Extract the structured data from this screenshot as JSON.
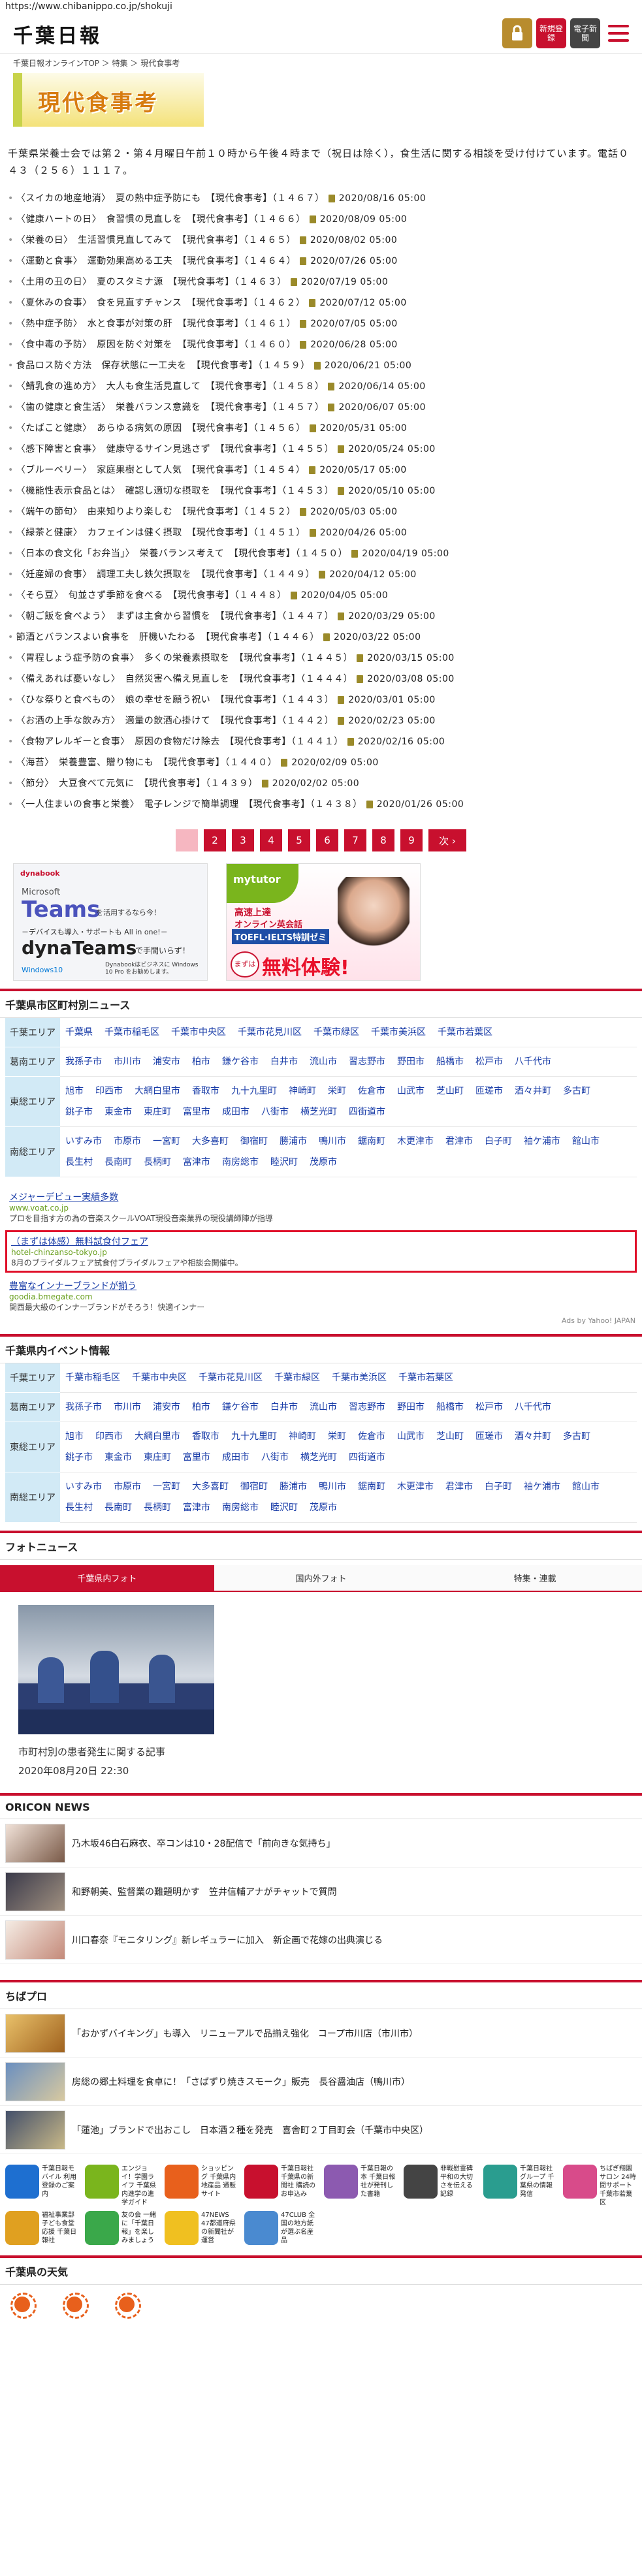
{
  "url": "https://www.chibanippo.co.jp/shokuji",
  "header": {
    "logo": "千葉日報",
    "lock_label": "",
    "register_label": "新規登録",
    "paper_label": "電子新聞"
  },
  "breadcrumb": "千葉日報オンラインTOP ＞ 特集 ＞ 現代食事考",
  "banner_title": "現代食事考",
  "intro": "千葉県栄養士会では第２・第４月曜日午前１０時から午後４時まで（祝日は除く），食生活に関する相談を受け付けています。電話０４３（２５６）１１１７。",
  "articles": [
    {
      "title": "〈スイカの地産地消〉　夏の熱中症予防にも　【現代食事考】（１４６７）",
      "date": "2020/08/16 05:00"
    },
    {
      "title": "〈健康ハートの日〉　食習慣の見直しを　【現代食事考】（１４６６）",
      "date": "2020/08/09 05:00"
    },
    {
      "title": "〈栄養の日〉　生活習慣見直してみて　【現代食事考】（１４６５）",
      "date": "2020/08/02 05:00"
    },
    {
      "title": "〈運動と食事〉　運動効果高める工夫　【現代食事考】（１４６４）",
      "date": "2020/07/26 05:00"
    },
    {
      "title": "〈土用の丑の日〉　夏のスタミナ源　【現代食事考】（１４６３）",
      "date": "2020/07/19 05:00"
    },
    {
      "title": "〈夏休みの食事〉　食を見直すチャンス　【現代食事考】（１４６２）",
      "date": "2020/07/12 05:00"
    },
    {
      "title": "〈熱中症予防〉　水と食事が対策の肝　【現代食事考】（１４６１）",
      "date": "2020/07/05 05:00"
    },
    {
      "title": "〈食中毒の予防〉　原因を防ぐ対策を　【現代食事考】（１４６０）",
      "date": "2020/06/28 05:00"
    },
    {
      "title": "食品ロス防ぐ方法　保存状態に一工夫を　【現代食事考】（１４５９）",
      "date": "2020/06/21 05:00"
    },
    {
      "title": "〈鯖乳食の進め方〉　大人も食生活見直して　【現代食事考】（１４５８）",
      "date": "2020/06/14 05:00"
    },
    {
      "title": "〈歯の健康と食生活〉　栄養バランス意識を　【現代食事考】（１４５７）",
      "date": "2020/06/07 05:00"
    },
    {
      "title": "〈たばこと健康〉　あらゆる病気の原因　【現代食事考】（１４５６）",
      "date": "2020/05/31 05:00"
    },
    {
      "title": "〈感下障害と食事〉　健康守るサイン見逃さず　【現代食事考】（１４５５）",
      "date": "2020/05/24 05:00"
    },
    {
      "title": "〈ブルーベリー〉　家庭果樹として人気　【現代食事考】（１４５４）",
      "date": "2020/05/17 05:00"
    },
    {
      "title": "〈機能性表示食品とは〉　確認し適切な摂取を　【現代食事考】（１４５３）",
      "date": "2020/05/10 05:00"
    },
    {
      "title": "〈端午の節句〉　由来知りより楽しむ　【現代食事考】（１４５２）",
      "date": "2020/05/03 05:00"
    },
    {
      "title": "〈緑茶と健康〉　カフェインは健く摂取　【現代食事考】（１４５１）",
      "date": "2020/04/26 05:00"
    },
    {
      "title": "〈日本の食文化「お弁当」〉　栄養バランス考えて　【現代食事考】（１４５０）",
      "date": "2020/04/19 05:00"
    },
    {
      "title": "〈妊産婦の食事〉　調理工夫し鉄欠摂取を　【現代食事考】（１４４９）",
      "date": "2020/04/12 05:00"
    },
    {
      "title": "〈そら豆〉　旬並さず季節を食べる　【現代食事考】（１４４８）",
      "date": "2020/04/05 05:00"
    },
    {
      "title": "〈朝ご飯を食べよう〉　まずは主食から習慣を　【現代食事考】（１４４７）",
      "date": "2020/03/29 05:00"
    },
    {
      "title": "節酒とバランスよい食事を　肝機いたわる　【現代食事考】（１４４６）",
      "date": "2020/03/22 05:00"
    },
    {
      "title": "〈胃程しょう症予防の食事〉　多くの栄養素摂取を　【現代食事考】（１４４５）",
      "date": "2020/03/15 05:00"
    },
    {
      "title": "〈備えあれば憂いなし〉　自然災害へ備え見直しを　【現代食事考】（１４４４）",
      "date": "2020/03/08 05:00"
    },
    {
      "title": "〈ひな祭りと食べもの〉　娘の幸せを願う祝い　【現代食事考】（１４４３）",
      "date": "2020/03/01 05:00"
    },
    {
      "title": "〈お酒の上手な飲み方〉　適量の飲酒心掛けて　【現代食事考】（１４４２）",
      "date": "2020/02/23 05:00"
    },
    {
      "title": "〈食物アレルギーと食事〉　原因の食物だけ除去　【現代食事考】（１４４１）",
      "date": "2020/02/16 05:00"
    },
    {
      "title": "〈海苔〉　栄養豊富、贈り物にも　【現代食事考】（１４４０）",
      "date": "2020/02/09 05:00"
    },
    {
      "title": "〈節分〉　大豆食べて元気に　【現代食事考】（１４３９）",
      "date": "2020/02/02 05:00"
    },
    {
      "title": "〈一人住まいの食事と栄養〉　電子レンジで簡単調理　【現代食事考】（１４３８）",
      "date": "2020/01/26 05:00"
    }
  ],
  "pager": {
    "pages": [
      "1",
      "2",
      "3",
      "4",
      "5",
      "6",
      "7",
      "8",
      "9"
    ],
    "next": "次 ›"
  },
  "ads": {
    "ad1_brand": "dynabook",
    "ad1_head": "Microsoft",
    "ad1_teams": "Teams",
    "ad1_teams_tail": "を活用するなら今！",
    "ad1_sub": "－デバイスも導入・サポートも All in one!－",
    "ad1_main": "dynaTeams",
    "ad1_main_tail": "で手間いらず！",
    "ad1_win": "Windows10",
    "ad1_note": "Dynabookはビジネスに Windows 10 Pro をお勧めします。",
    "ad2_brand": "mytutor",
    "ad2_line1": "高速上達",
    "ad2_line2": "オンライン英会話",
    "ad2_line3": "TOEFL·IELTS特訓ゼミ",
    "ad2_badge": "まずは",
    "ad2_cta": "無料体験!"
  },
  "city_news": {
    "title": "千葉県市区町村別ニュース",
    "rows": [
      {
        "label": "千葉エリア",
        "items": [
          "千葉県",
          "千葉市稲毛区",
          "千葉市中央区",
          "千葉市花見川区",
          "千葉市緑区",
          "千葉市美浜区",
          "千葉市若葉区"
        ]
      },
      {
        "label": "葛南エリア",
        "items": [
          "我孫子市",
          "市川市",
          "浦安市",
          "柏市",
          "鎌ケ谷市",
          "白井市",
          "流山市",
          "習志野市",
          "野田市",
          "船橋市",
          "松戸市",
          "八千代市"
        ]
      },
      {
        "label": "東総エリア",
        "items": [
          "旭市",
          "印西市",
          "大網白里市",
          "香取市",
          "九十九里町",
          "神崎町",
          "栄町",
          "佐倉市",
          "山武市",
          "芝山町",
          "匝瑳市",
          "酒々井町",
          "多古町",
          "銚子市",
          "東金市",
          "東庄町",
          "富里市",
          "成田市",
          "八街市",
          "横芝光町",
          "四街道市"
        ]
      },
      {
        "label": "南総エリア",
        "items": [
          "いすみ市",
          "市原市",
          "一宮町",
          "大多喜町",
          "御宿町",
          "勝浦市",
          "鴨川市",
          "鋸南町",
          "木更津市",
          "君津市",
          "白子町",
          "袖ケ浦市",
          "館山市",
          "長生村",
          "長南町",
          "長柄町",
          "富津市",
          "南房総市",
          "睦沢町",
          "茂原市"
        ]
      }
    ]
  },
  "sponsors": [
    {
      "title": "メジャーデビュー実績多数",
      "url": "www.voat.co.jp",
      "desc": "プロを目指す方の為の音楽スクールVOAT現役音楽業界の現役講師陣が指導"
    },
    {
      "title": "（まずは体感）無料試食付フェア",
      "url": "hotel-chinzanso-tokyo.jp",
      "desc": "8月のブライダルフェア試食付ブライダルフェアや相談会開催中。"
    },
    {
      "title": "豊富なインナーブランドが揃う",
      "url": "goodia.bmegate.com",
      "desc": "関西最大級のインナーブランドがそろう！快適インナー"
    }
  ],
  "ads_by": "Ads by Yahoo! JAPAN",
  "event_info": {
    "title": "千葉県内イベント情報",
    "rows": [
      {
        "label": "千葉エリア",
        "items": [
          "千葉市稲毛区",
          "千葉市中央区",
          "千葉市花見川区",
          "千葉市緑区",
          "千葉市美浜区",
          "千葉市若葉区"
        ]
      },
      {
        "label": "葛南エリア",
        "items": [
          "我孫子市",
          "市川市",
          "浦安市",
          "柏市",
          "鎌ケ谷市",
          "白井市",
          "流山市",
          "習志野市",
          "野田市",
          "船橋市",
          "松戸市",
          "八千代市"
        ]
      },
      {
        "label": "東総エリア",
        "items": [
          "旭市",
          "印西市",
          "大網白里市",
          "香取市",
          "九十九里町",
          "神崎町",
          "栄町",
          "佐倉市",
          "山武市",
          "芝山町",
          "匝瑳市",
          "酒々井町",
          "多古町",
          "銚子市",
          "東金市",
          "東庄町",
          "富里市",
          "成田市",
          "八街市",
          "横芝光町",
          "四街道市"
        ]
      },
      {
        "label": "南総エリア",
        "items": [
          "いすみ市",
          "市原市",
          "一宮町",
          "大多喜町",
          "御宿町",
          "勝浦市",
          "鴨川市",
          "鋸南町",
          "木更津市",
          "君津市",
          "白子町",
          "袖ケ浦市",
          "館山市",
          "長生村",
          "長南町",
          "長柄町",
          "富津市",
          "南房総市",
          "睦沢町",
          "茂原市"
        ]
      }
    ]
  },
  "photo_news": {
    "title": "フォトニュース",
    "tabs": [
      "千葉県内フォト",
      "国内外フォト",
      "特集・連載"
    ],
    "caption": "市町村別の患者発生に関する記事",
    "date": "2020年08月20日 22:30"
  },
  "oricon": {
    "title": "ORICON NEWS",
    "items": [
      "乃木坂46白石麻衣、卒コンは10・28配信で「前向きな気持ち」",
      "和野朝美、監督業の難題明かす　笠井信輔アナがチャットで質問",
      "川口春奈『モニタリング』新レギュラーに加入　新企画で花嫁の出典演じる"
    ]
  },
  "chipro": {
    "title": "ちばプロ",
    "items": [
      "「おかずバイキング」も導入　リニューアルで品揃え強化　コープ市川店（市川市）",
      "房総の郷土料理を食卓に！「さばずり焼きスモーク」販売　長谷醤油店（鴨川市）",
      "「蓮池」ブランドで出おこし　日本酒２種を発売　喜舎町２丁目町会（千葉市中央区）"
    ]
  },
  "apps": [
    {
      "text": "千葉日報モバイル 利用登録のご案内"
    },
    {
      "text": "エンジョイ！学園ライフ 千葉県内進学の進学ガイド"
    },
    {
      "text": "ショッピング 千葉県内地産品 通販サイト"
    },
    {
      "text": "千葉日報社 千葉県の新聞社 購読のお申込み"
    },
    {
      "text": "千葉日報の本 千葉日報社が発刊した書籍"
    },
    {
      "text": "非戦慰霊碑 平和の大切さを伝える記録"
    },
    {
      "text": "千葉日報社グループ 千葉県の情報発信"
    },
    {
      "text": "ちばぎ翔園 サロン 24時間サポート 千葉市若葉区"
    },
    {
      "text": "福祉事業部 子ども食堂応援 千葉日報社"
    },
    {
      "text": "友の会 一緒に「千葉日報」を楽しみましょう"
    },
    {
      "text": "47NEWS 47都道府県の新聞社が運営"
    },
    {
      "text": "47CLUB 全国の地方紙が選ぶ名産品"
    }
  ],
  "weather": {
    "title": "千葉県の天気",
    "icons": [
      "sun-icon",
      "sun-icon",
      "sun-icon"
    ]
  },
  "colors": {
    "accent": "#c8102e",
    "area_bg": "#d2eaf6",
    "link": "#1a3da8"
  }
}
